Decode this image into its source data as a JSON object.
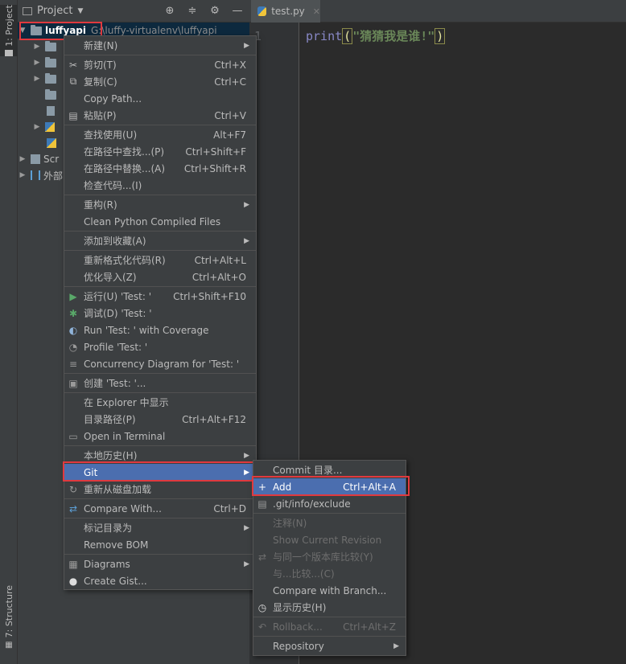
{
  "stripe": {
    "project_tab": "1: Project",
    "structure_tab": "7: Structure"
  },
  "project_panel": {
    "title": "Project",
    "root": {
      "name": "luffyapi",
      "path": "G:\\luffy-virtualenv\\luffyapi"
    },
    "partial_rows": [
      "Scr",
      "外部"
    ]
  },
  "editor": {
    "tab_label": "test.py",
    "line_number": "1",
    "code_func": "print",
    "code_paren_open": "(",
    "code_string": "\"猜猜我是谁!\"",
    "code_paren_close": ")"
  },
  "context_menu": {
    "items": [
      {
        "label": "新建(N)",
        "arrow": true
      },
      {
        "label": "剪切(T)",
        "shortcut": "Ctrl+X"
      },
      {
        "label": "复制(C)",
        "shortcut": "Ctrl+C"
      },
      {
        "label": "Copy Path..."
      },
      {
        "label": "粘贴(P)",
        "shortcut": "Ctrl+V"
      },
      {
        "label": "查找使用(U)",
        "shortcut": "Alt+F7"
      },
      {
        "label": "在路径中查找...(P)",
        "shortcut": "Ctrl+Shift+F"
      },
      {
        "label": "在路径中替换...(A)",
        "shortcut": "Ctrl+Shift+R"
      },
      {
        "label": "检查代码...(I)"
      },
      {
        "label": "重构(R)",
        "arrow": true
      },
      {
        "label": "Clean Python Compiled Files"
      },
      {
        "label": "添加到收藏(A)",
        "arrow": true
      },
      {
        "label": "重新格式化代码(R)",
        "shortcut": "Ctrl+Alt+L"
      },
      {
        "label": "优化导入(Z)",
        "shortcut": "Ctrl+Alt+O"
      },
      {
        "label": "运行(U) 'Test: '",
        "shortcut": "Ctrl+Shift+F10"
      },
      {
        "label": "调试(D) 'Test: '"
      },
      {
        "label": "Run 'Test: ' with Coverage"
      },
      {
        "label": "Profile 'Test: '"
      },
      {
        "label": "Concurrency Diagram for 'Test: '"
      },
      {
        "label": "创建 'Test: '..."
      },
      {
        "label": "在 Explorer 中显示"
      },
      {
        "label": "目录路径(P)",
        "shortcut": "Ctrl+Alt+F12"
      },
      {
        "label": "Open in Terminal"
      },
      {
        "label": "本地历史(H)",
        "arrow": true
      },
      {
        "label": "Git",
        "arrow": true
      },
      {
        "label": "重新从磁盘加载"
      },
      {
        "label": "Compare With...",
        "shortcut": "Ctrl+D"
      },
      {
        "label": "标记目录为",
        "arrow": true
      },
      {
        "label": "Remove BOM"
      },
      {
        "label": "Diagrams",
        "arrow": true
      },
      {
        "label": "Create Gist..."
      }
    ]
  },
  "git_submenu": {
    "items": [
      {
        "label": "Commit 目录..."
      },
      {
        "label": "Add",
        "shortcut": "Ctrl+Alt+A"
      },
      {
        "label": ".git/info/exclude"
      },
      {
        "label": "注释(N)"
      },
      {
        "label": "Show Current Revision"
      },
      {
        "label": "与同一个版本库比较(Y)"
      },
      {
        "label": "与...比较...(C)"
      },
      {
        "label": "Compare with Branch..."
      },
      {
        "label": "显示历史(H)"
      },
      {
        "label": "Rollback...",
        "shortcut": "Ctrl+Alt+Z"
      },
      {
        "label": "Repository",
        "arrow": true
      }
    ]
  },
  "colors": {
    "highlight": "#4b6eaf",
    "annotation_red": "#e0393e",
    "background": "#3c3f41",
    "editor_bg": "#2b2b2b"
  }
}
